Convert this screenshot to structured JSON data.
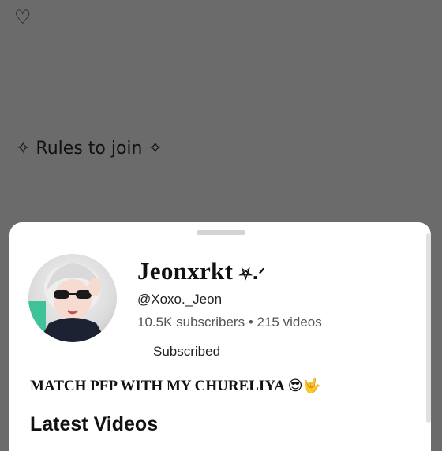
{
  "background": {
    "heart_glyph": "♡",
    "rules_text": "✧ Rules to join ✧"
  },
  "channel": {
    "name": "Jeonxrkt",
    "name_decoration": "⛧.ᐟ",
    "handle": "@Xoxo._Jeon",
    "subscribers": "10.5K subscribers",
    "separator": "•",
    "videos": "215 videos",
    "subscribe_label": "Subscribed",
    "description": "MATCH PFP WITH MY CHURELIYA",
    "description_emoji": "😎🤟"
  },
  "sections": {
    "latest_videos_title": "Latest Videos"
  },
  "colors": {
    "overlay": "#6b6b6b",
    "sheet": "#ffffff",
    "text_primary": "#111111",
    "text_secondary": "#555555"
  }
}
